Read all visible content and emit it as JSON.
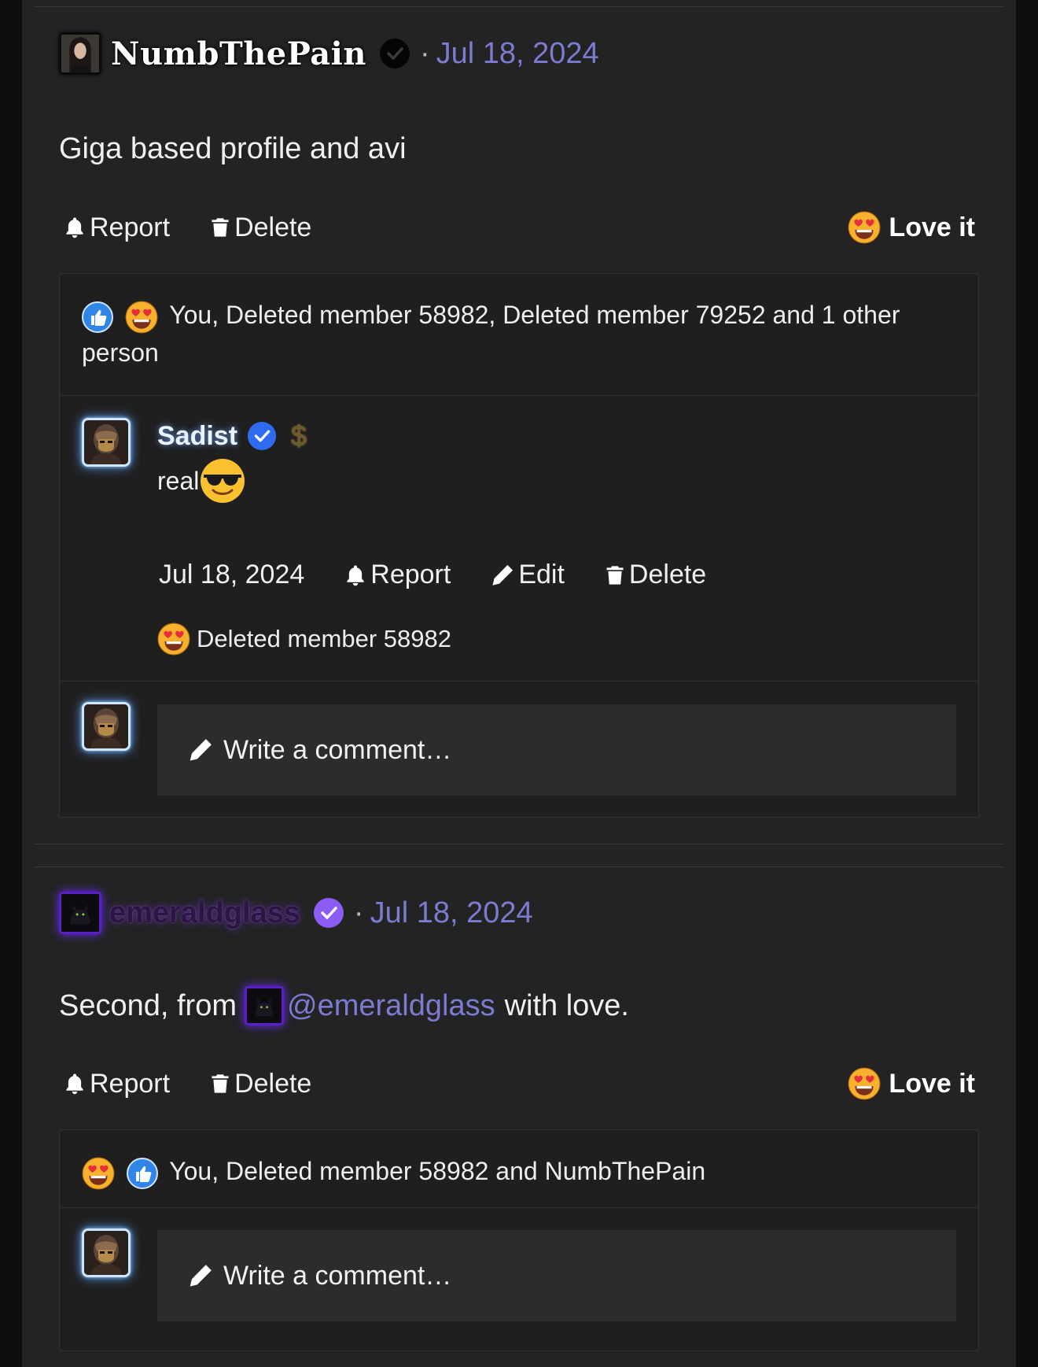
{
  "posts": [
    {
      "username": "NumbThePain",
      "date": "Jul 18, 2024",
      "body": "Giga based profile and avi",
      "actions": {
        "report": "Report",
        "delete": "Delete"
      },
      "reaction_button": "Love it",
      "reactions_summary": "You, Deleted member 58982, Deleted member 79252 and 1 other person",
      "comments": [
        {
          "username": "Sadist",
          "text": "real",
          "date": "Jul 18, 2024",
          "actions": {
            "report": "Report",
            "edit": "Edit",
            "delete": "Delete"
          },
          "reactions_summary": "Deleted member 58982"
        }
      ],
      "write_placeholder": "Write a comment…"
    },
    {
      "username": "emeraldglass",
      "date": "Jul 18, 2024",
      "body_prefix": "Second, from",
      "mention": "@emeraldglass",
      "body_suffix": "with love.",
      "actions": {
        "report": "Report",
        "delete": "Delete"
      },
      "reaction_button": "Love it",
      "reactions_summary": "You, Deleted member 58982 and NumbThePain",
      "write_placeholder": "Write a comment…"
    }
  ],
  "icons": {
    "report": "bell-icon",
    "delete": "trash-icon",
    "edit": "pencil-icon",
    "verified": "verified-check-icon",
    "dollar": "dollar-icon",
    "love": "heart-eyes-emoji",
    "like": "thumbs-up-icon",
    "cool": "sunglasses-emoji"
  },
  "colors": {
    "background": "#232324",
    "date_link": "#7b7bd2",
    "mention": "#7b7bd2",
    "verified_blue": "#2f6bf0",
    "verified_purple": "#8b5cf6"
  }
}
